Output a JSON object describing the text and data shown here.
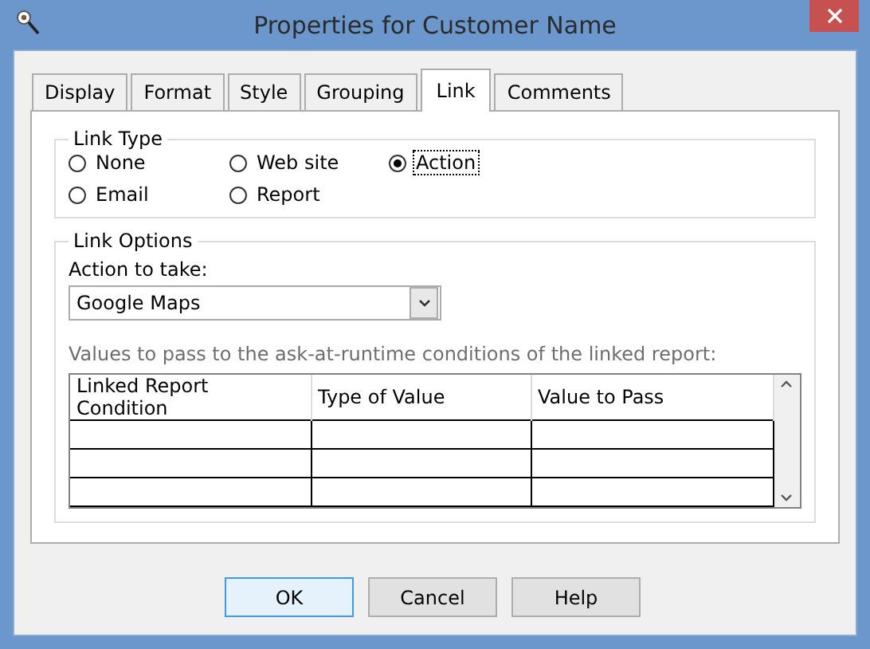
{
  "window": {
    "title": "Properties for Customer Name"
  },
  "tabs": [
    {
      "label": "Display",
      "selected": false
    },
    {
      "label": "Format",
      "selected": false
    },
    {
      "label": "Style",
      "selected": false
    },
    {
      "label": "Grouping",
      "selected": false
    },
    {
      "label": "Link",
      "selected": true
    },
    {
      "label": "Comments",
      "selected": false
    }
  ],
  "link_type": {
    "title": "Link Type",
    "options": [
      {
        "label": "None",
        "selected": false,
        "focused": false
      },
      {
        "label": "Web site",
        "selected": false,
        "focused": false
      },
      {
        "label": "Action",
        "selected": true,
        "focused": true
      },
      {
        "label": "Email",
        "selected": false,
        "focused": false
      },
      {
        "label": "Report",
        "selected": false,
        "focused": false
      }
    ]
  },
  "link_options": {
    "title": "Link Options",
    "action_label": "Action to take:",
    "action_value": "Google Maps",
    "values_label": "Values to pass to the ask-at-runtime conditions of the linked report:",
    "table": {
      "columns": [
        "Linked Report Condition",
        "Type of Value",
        "Value to Pass"
      ]
    }
  },
  "buttons": [
    {
      "label": "OK",
      "default": true
    },
    {
      "label": "Cancel",
      "default": false
    },
    {
      "label": "Help",
      "default": false
    }
  ]
}
